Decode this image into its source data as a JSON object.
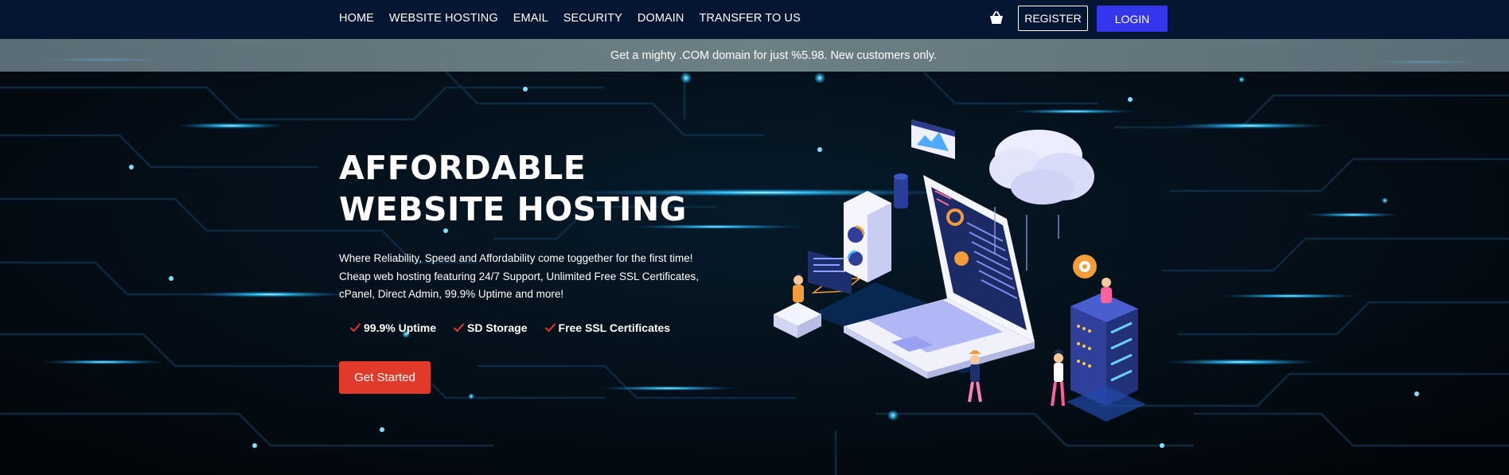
{
  "nav": {
    "items": [
      {
        "label": "HOME"
      },
      {
        "label": "WEBSITE HOSTING"
      },
      {
        "label": "EMAIL"
      },
      {
        "label": "SECURITY"
      },
      {
        "label": "DOMAIN"
      },
      {
        "label": "TRANSFER TO US"
      }
    ],
    "cart_icon": "basket-icon",
    "register_label": "REGISTER",
    "login_label": "LOGIN"
  },
  "promo": {
    "text": "Get a mighty .COM domain for just %5.98. New customers only."
  },
  "hero": {
    "title_lines": [
      "AFFORDABLE",
      "WEBSITE HOSTING"
    ],
    "description_lines": [
      "Where Reliability, Speed and Affordability come toggether for the first time!",
      "Cheap web hosting featuring 24/7 Support, Unlimited Free SSL Certificates,",
      "cPanel, Direct Admin, 99.9% Uptime and more!"
    ],
    "features": [
      {
        "icon": "check-icon",
        "label": "99.9% Uptime"
      },
      {
        "icon": "check-icon",
        "label": "SD Storage"
      },
      {
        "icon": "check-icon",
        "label": "Free SSL Certificates"
      }
    ],
    "cta_label": "Get Started"
  },
  "colors": {
    "nav_background": "#051633",
    "login_button": "#3535ec",
    "cta_button": "#e23a2a",
    "check_mark": "#e23a2a",
    "accent_glow": "#2fc8ff"
  }
}
